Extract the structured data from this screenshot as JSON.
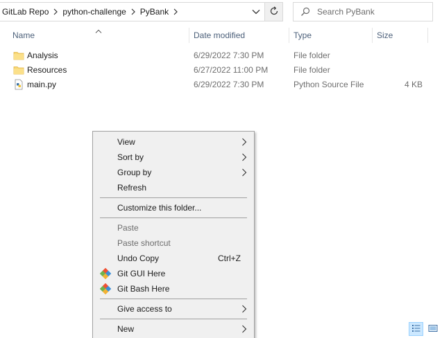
{
  "address_bar": {
    "crumbs": [
      "GitLab Repo",
      "python-challenge",
      "PyBank"
    ]
  },
  "search": {
    "placeholder": "Search PyBank"
  },
  "columns": {
    "name": "Name",
    "date_modified": "Date modified",
    "type": "Type",
    "size": "Size"
  },
  "files": [
    {
      "name": "Analysis",
      "date": "6/29/2022 7:30 PM",
      "type": "File folder",
      "size": "",
      "icon": "folder-icon"
    },
    {
      "name": "Resources",
      "date": "6/27/2022 11:00 PM",
      "type": "File folder",
      "size": "",
      "icon": "folder-icon"
    },
    {
      "name": "main.py",
      "date": "6/29/2022 7:30 PM",
      "type": "Python Source File",
      "size": "4 KB",
      "icon": "python-file-icon"
    }
  ],
  "context_menu": {
    "view": "View",
    "sort_by": "Sort by",
    "group_by": "Group by",
    "refresh": "Refresh",
    "customize": "Customize this folder...",
    "paste": "Paste",
    "paste_shortcut": "Paste shortcut",
    "undo_copy": "Undo Copy",
    "undo_shortcut": "Ctrl+Z",
    "git_gui": "Git GUI Here",
    "git_bash": "Git Bash Here",
    "give_access": "Give access to",
    "new": "New"
  },
  "colors": {
    "folder": "#f8d775",
    "column_header_text": "#4c607a",
    "menu_background": "#f0f0f0",
    "active_view_button": "#cce8ff"
  }
}
